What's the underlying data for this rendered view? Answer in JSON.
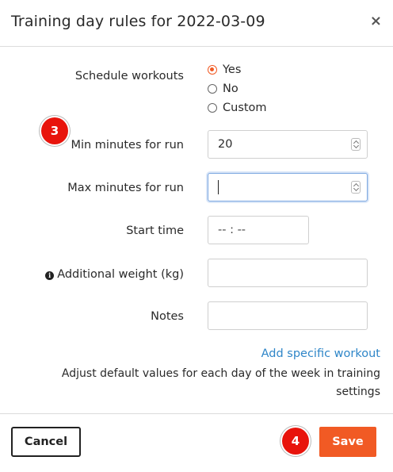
{
  "dialog": {
    "title": "Training day rules for 2022-03-09",
    "close_symbol": "×"
  },
  "form": {
    "schedule_label": "Schedule workouts",
    "schedule_options": [
      "Yes",
      "No",
      "Custom"
    ],
    "schedule_selected": "Yes",
    "min_label": "Min minutes for run",
    "min_value": "20",
    "max_label": "Max minutes for run",
    "max_value": "",
    "start_label": "Start time",
    "start_placeholder": "-- : --",
    "weight_label": "Additional weight (kg)",
    "weight_value": "",
    "notes_label": "Notes",
    "notes_value": ""
  },
  "links": {
    "add_workout": "Add specific workout"
  },
  "help_text": "Adjust default values for each day of the week in training settings",
  "badges": {
    "badge_3": "3",
    "badge_4": "4"
  },
  "footer": {
    "cancel_label": "Cancel",
    "save_label": "Save"
  },
  "colors": {
    "accent": "#f15a24",
    "link": "#2f86c8",
    "badge": "#e8140c"
  },
  "icons": {
    "info": "info-circle-icon",
    "close": "close-icon"
  }
}
